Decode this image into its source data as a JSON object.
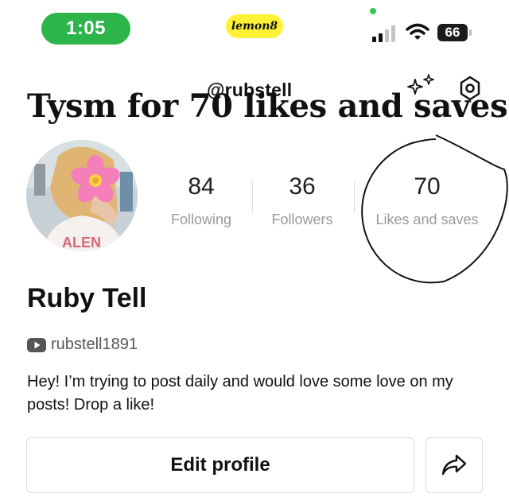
{
  "status_bar": {
    "time": "1:05",
    "app_label": "lemon8",
    "battery": "66"
  },
  "overlay": {
    "handle": "@rubstell",
    "headline": "Tysm for 70 likes and saves!"
  },
  "profile": {
    "name": "Ruby Tell",
    "youtube_handle": "rubstell1891",
    "bio": "Hey! I’m trying to post daily and would love some love on my posts! Drop a like!"
  },
  "stats": [
    {
      "value": "84",
      "label": "Following"
    },
    {
      "value": "36",
      "label": "Followers"
    },
    {
      "value": "70",
      "label": "Likes and saves"
    }
  ],
  "actions": {
    "edit_profile": "Edit profile"
  },
  "colors": {
    "time_pill": "#2db54b",
    "app_pill": "#fff236",
    "stat_label": "#9a9a9a"
  }
}
